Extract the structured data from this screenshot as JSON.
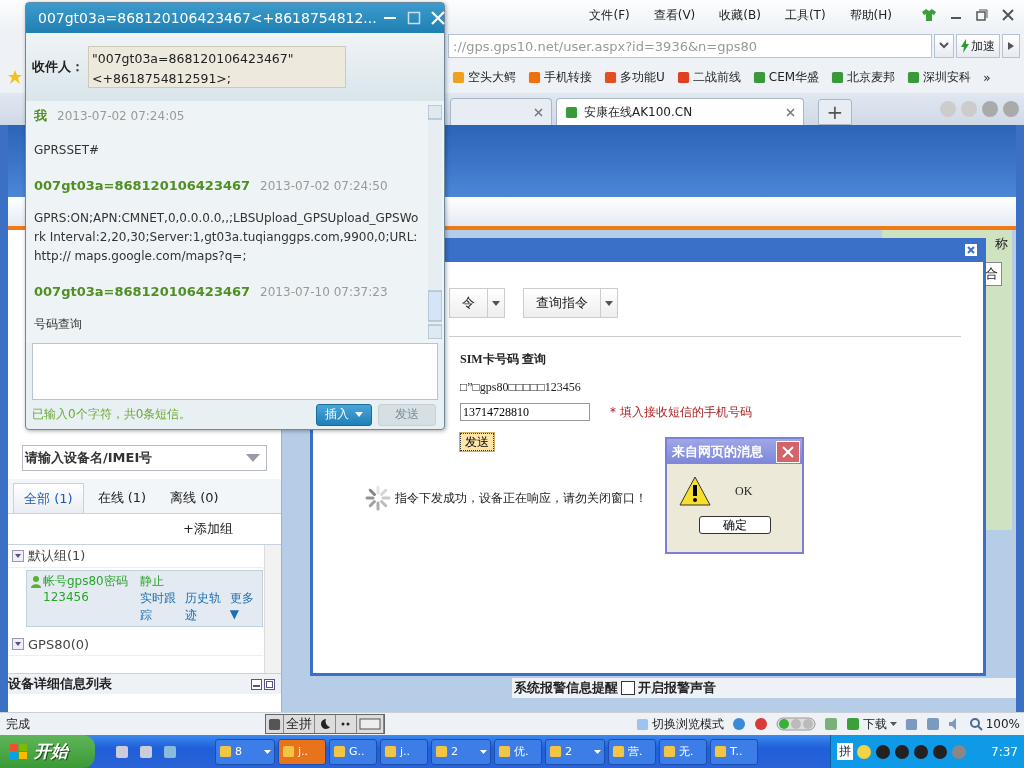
{
  "browser": {
    "menu": [
      "文件(F)",
      "查看(V)",
      "收藏(B)",
      "工具(T)",
      "帮助(H)"
    ],
    "address": "://gps.gps10.net/user.aspx?id=3936&n=gps80",
    "speed_button": "加速",
    "favorites": [
      "空头大鳄",
      "手机转接",
      "多功能U",
      "二战前线",
      "CEM华盛",
      "北京麦邦",
      "深圳安科"
    ],
    "more": "»",
    "tabs": [
      {
        "selected": false
      },
      {
        "label": "安康在线AK100.CN",
        "selected": true
      }
    ],
    "new_tab": "+"
  },
  "page": {
    "header_right": "称",
    "map_button": "合",
    "search": {
      "placeholder": "请输入设备名/IMEI号"
    },
    "filter_tabs": [
      {
        "label": "全部 (1)",
        "selected": true
      },
      {
        "label": "在线 (1)",
        "selected": false
      },
      {
        "label": "离线 (0)",
        "selected": false
      }
    ],
    "add_group": "+添加组",
    "groups": [
      {
        "name": "默认组(1)",
        "devices": [
          {
            "name": "帐号gps80密码",
            "code": "123456",
            "status": "静止",
            "actions": [
              "实时跟踪",
              "历史轨迹",
              "更多▼"
            ]
          }
        ]
      },
      {
        "name": "GPS80(0)"
      }
    ],
    "detail_panel": "设备详细信息列表",
    "alarm_bar": {
      "label": "系统报警信息提醒",
      "sound": {
        "label": "开启报警声音",
        "checked": false
      }
    }
  },
  "command_dialog": {
    "tabs": [
      "令",
      "查询指令"
    ],
    "title": "SIM卡号码 查询",
    "info": "□”□gps80□□□□□123456",
    "phone": {
      "value": "13714728810"
    },
    "hint": "* 填入接收短信的手机号码",
    "send": "发送",
    "status": "指令下发成功，设备正在响应，请勿关闭窗口！"
  },
  "alert": {
    "title": "来自网页的消息",
    "message": "OK",
    "button": "确定"
  },
  "chat": {
    "title": "007gt03a=868120106423467<+8618754812...",
    "recipient_label": "收件人：",
    "recipient": "\"007gt03a=868120106423467\" <+8618754812591>;",
    "messages": [
      {
        "sender": "我",
        "time": "2013-07-02 07:24:05",
        "text": "GPRSSET#"
      },
      {
        "sender": "007gt03a=868120106423467",
        "time": "2013-07-02 07:24:50",
        "text": "GPRS:ON;APN:CMNET,0,0.0.0.0,,;LBSUpload_GPSUpload_GPSWork Interval:2,20,30;Server:1,gt03a.tuqianggps.com,9900,0;URL:http:// maps.google.com/maps?q=;"
      },
      {
        "sender": "007gt03a=868120106423467",
        "time": "2013-07-10 07:37:23",
        "text": "号码查询"
      }
    ],
    "counter": "已输入0个字符，共0条短信。",
    "insert_button": "插入",
    "send_button": {
      "label": "发送",
      "disabled": true
    }
  },
  "status_bar": {
    "text": "完成",
    "ime": "全拼",
    "browse_mode": "切换浏览模式",
    "download": "下载",
    "zoom": "100%"
  },
  "taskbar": {
    "start": "开始",
    "items": [
      {
        "label": "8",
        "grouped": true,
        "active": false
      },
      {
        "label": "j..",
        "grouped": false,
        "active": true
      },
      {
        "label": "G..",
        "grouped": false,
        "active": false
      },
      {
        "label": "j..",
        "grouped": false,
        "active": false
      },
      {
        "label": "2",
        "grouped": true,
        "active": false
      },
      {
        "label": "优.",
        "grouped": false,
        "active": false
      },
      {
        "label": "2",
        "grouped": true,
        "active": false
      },
      {
        "label": "营.",
        "grouped": false,
        "active": false
      },
      {
        "label": "无.",
        "grouped": false,
        "active": false
      },
      {
        "label": "T..",
        "grouped": false,
        "active": false
      }
    ],
    "ime": "拼",
    "clock": "7:37"
  }
}
